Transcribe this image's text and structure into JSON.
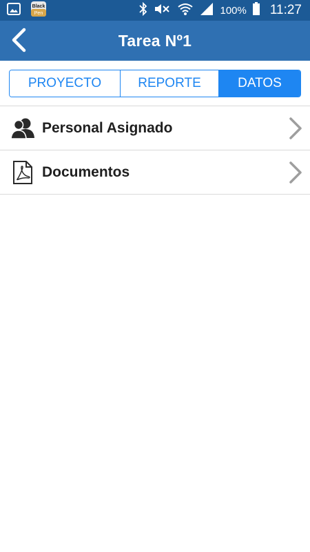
{
  "status_bar": {
    "notification_icons": [
      "image-icon",
      "blackpen-app-icon"
    ],
    "battery_percent": "100%",
    "time": "11:27"
  },
  "header": {
    "title": "Tarea Nº1",
    "back_icon": "chevron-left-icon"
  },
  "tabs": [
    {
      "label": "PROYECTO",
      "active": false
    },
    {
      "label": "REPORTE",
      "active": false
    },
    {
      "label": "DATOS",
      "active": true
    }
  ],
  "list": {
    "items": [
      {
        "label": "Personal Asignado",
        "icon": "users-icon"
      },
      {
        "label": "Documentos",
        "icon": "pdf-document-icon"
      }
    ]
  },
  "colors": {
    "status_bar": "#1c5a96",
    "header": "#2f70b2",
    "accent": "#1e86f2",
    "divider": "#d9d9d9",
    "chevron": "#9e9e9e"
  }
}
